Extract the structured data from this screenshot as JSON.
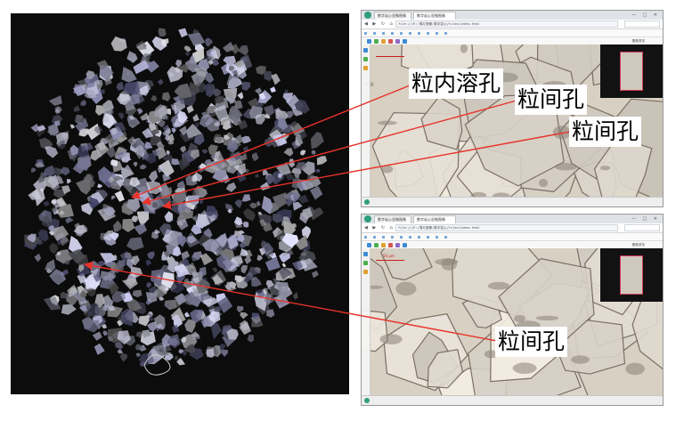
{
  "labels": {
    "intragranular_pore": "粒内溶孔",
    "intergranular_pore_a": "粒间孔",
    "intergranular_pore_b": "粒间孔",
    "intergranular_pore_c": "粒间孔"
  },
  "browser_top": {
    "tab1": "数字岩心显微图像",
    "tab2": "数字岩心显微图像",
    "url": "file:///E:/薄片图像/数字岩心/tiles/index.html",
    "toolbar_label": "图像浏览"
  },
  "browser_bottom": {
    "tab1": "数字岩心显微图像",
    "tab2": "数字岩心显微图像",
    "url": "file:///E:/薄片图像/数字岩心/tiles/index.html",
    "toolbar_label": "图像浏览",
    "scale_label": "50 μm"
  },
  "colors": {
    "arrow": "#e8332a",
    "thin_section_bg": "#0c0c0c",
    "viewer_bg": "#ded6c6"
  }
}
